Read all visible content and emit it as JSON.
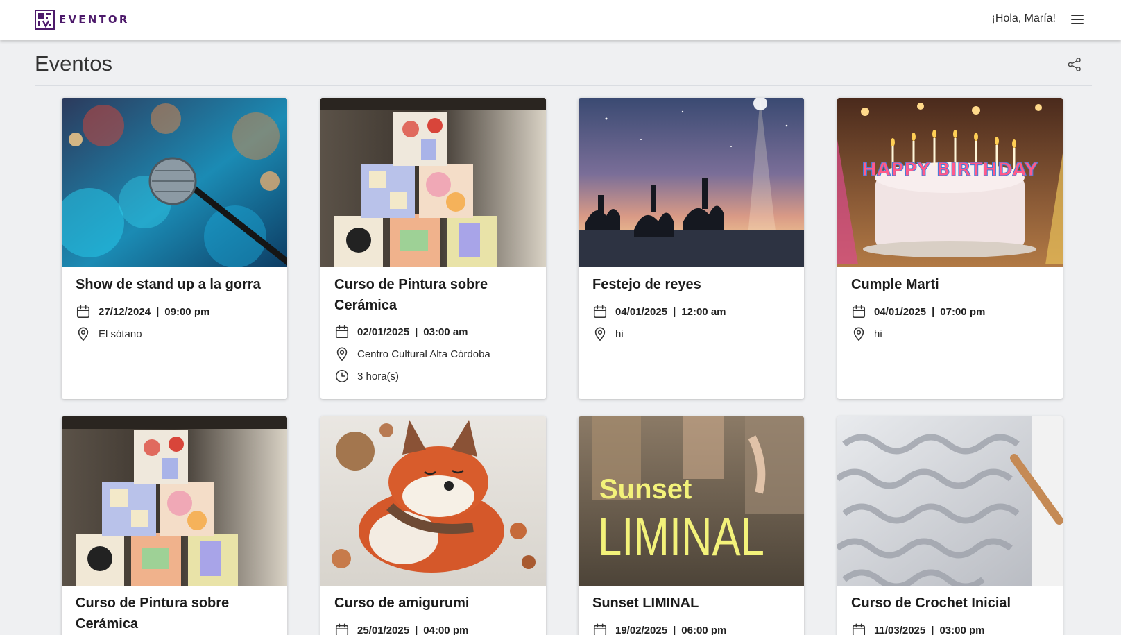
{
  "header": {
    "logo_text": "EVENTOR",
    "greeting": "¡Hola, María!",
    "accent_color": "#4d1a6b"
  },
  "page": {
    "title": "Eventos"
  },
  "events": [
    {
      "title": "Show de stand up a la gorra",
      "date": "27/12/2024",
      "time": "09:00 pm",
      "location": "El sótano",
      "duration": ""
    },
    {
      "title": "Curso de Pintura sobre Cerámica",
      "date": "02/01/2025",
      "time": "03:00 am",
      "location": "Centro Cultural Alta Córdoba",
      "duration": "3 hora(s)"
    },
    {
      "title": "Festejo de reyes",
      "date": "04/01/2025",
      "time": "12:00 am",
      "location": "hi",
      "duration": ""
    },
    {
      "title": "Cumple Marti",
      "date": "04/01/2025",
      "time": "07:00 pm",
      "location": "hi",
      "duration": ""
    },
    {
      "title": "Curso de Pintura sobre Cerámica",
      "date": "",
      "time": "",
      "location": "",
      "duration": ""
    },
    {
      "title": "Curso de amigurumi",
      "date": "25/01/2025",
      "time": "04:00 pm",
      "location": "",
      "duration": ""
    },
    {
      "title": "Sunset LIMINAL",
      "date": "19/02/2025",
      "time": "06:00 pm",
      "location": "",
      "duration": ""
    },
    {
      "title": "Curso de Crochet Inicial",
      "date": "11/03/2025",
      "time": "03:00 pm",
      "location": "",
      "duration": ""
    }
  ],
  "image_text": {
    "birthday": "HAPPY BIRTHDAY",
    "sunset_line1": "Sunset",
    "sunset_line2": "LIMINAL"
  },
  "icons": {
    "date": "calendar-icon",
    "location": "map-pin-icon",
    "duration": "clock-icon",
    "share": "share-icon",
    "menu": "hamburger-menu-icon"
  }
}
